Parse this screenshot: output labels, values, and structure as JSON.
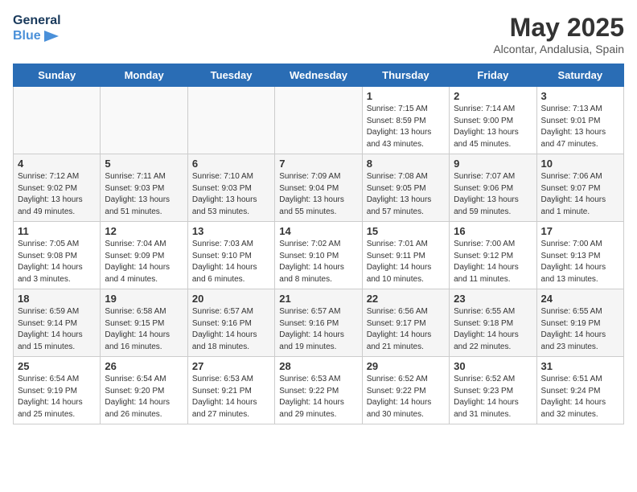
{
  "header": {
    "logo_line1": "General",
    "logo_line2": "Blue",
    "title": "May 2025",
    "subtitle": "Alcontar, Andalusia, Spain"
  },
  "weekdays": [
    "Sunday",
    "Monday",
    "Tuesday",
    "Wednesday",
    "Thursday",
    "Friday",
    "Saturday"
  ],
  "weeks": [
    [
      {
        "day": "",
        "info": ""
      },
      {
        "day": "",
        "info": ""
      },
      {
        "day": "",
        "info": ""
      },
      {
        "day": "",
        "info": ""
      },
      {
        "day": "1",
        "info": "Sunrise: 7:15 AM\nSunset: 8:59 PM\nDaylight: 13 hours\nand 43 minutes."
      },
      {
        "day": "2",
        "info": "Sunrise: 7:14 AM\nSunset: 9:00 PM\nDaylight: 13 hours\nand 45 minutes."
      },
      {
        "day": "3",
        "info": "Sunrise: 7:13 AM\nSunset: 9:01 PM\nDaylight: 13 hours\nand 47 minutes."
      }
    ],
    [
      {
        "day": "4",
        "info": "Sunrise: 7:12 AM\nSunset: 9:02 PM\nDaylight: 13 hours\nand 49 minutes."
      },
      {
        "day": "5",
        "info": "Sunrise: 7:11 AM\nSunset: 9:03 PM\nDaylight: 13 hours\nand 51 minutes."
      },
      {
        "day": "6",
        "info": "Sunrise: 7:10 AM\nSunset: 9:03 PM\nDaylight: 13 hours\nand 53 minutes."
      },
      {
        "day": "7",
        "info": "Sunrise: 7:09 AM\nSunset: 9:04 PM\nDaylight: 13 hours\nand 55 minutes."
      },
      {
        "day": "8",
        "info": "Sunrise: 7:08 AM\nSunset: 9:05 PM\nDaylight: 13 hours\nand 57 minutes."
      },
      {
        "day": "9",
        "info": "Sunrise: 7:07 AM\nSunset: 9:06 PM\nDaylight: 13 hours\nand 59 minutes."
      },
      {
        "day": "10",
        "info": "Sunrise: 7:06 AM\nSunset: 9:07 PM\nDaylight: 14 hours\nand 1 minute."
      }
    ],
    [
      {
        "day": "11",
        "info": "Sunrise: 7:05 AM\nSunset: 9:08 PM\nDaylight: 14 hours\nand 3 minutes."
      },
      {
        "day": "12",
        "info": "Sunrise: 7:04 AM\nSunset: 9:09 PM\nDaylight: 14 hours\nand 4 minutes."
      },
      {
        "day": "13",
        "info": "Sunrise: 7:03 AM\nSunset: 9:10 PM\nDaylight: 14 hours\nand 6 minutes."
      },
      {
        "day": "14",
        "info": "Sunrise: 7:02 AM\nSunset: 9:10 PM\nDaylight: 14 hours\nand 8 minutes."
      },
      {
        "day": "15",
        "info": "Sunrise: 7:01 AM\nSunset: 9:11 PM\nDaylight: 14 hours\nand 10 minutes."
      },
      {
        "day": "16",
        "info": "Sunrise: 7:00 AM\nSunset: 9:12 PM\nDaylight: 14 hours\nand 11 minutes."
      },
      {
        "day": "17",
        "info": "Sunrise: 7:00 AM\nSunset: 9:13 PM\nDaylight: 14 hours\nand 13 minutes."
      }
    ],
    [
      {
        "day": "18",
        "info": "Sunrise: 6:59 AM\nSunset: 9:14 PM\nDaylight: 14 hours\nand 15 minutes."
      },
      {
        "day": "19",
        "info": "Sunrise: 6:58 AM\nSunset: 9:15 PM\nDaylight: 14 hours\nand 16 minutes."
      },
      {
        "day": "20",
        "info": "Sunrise: 6:57 AM\nSunset: 9:16 PM\nDaylight: 14 hours\nand 18 minutes."
      },
      {
        "day": "21",
        "info": "Sunrise: 6:57 AM\nSunset: 9:16 PM\nDaylight: 14 hours\nand 19 minutes."
      },
      {
        "day": "22",
        "info": "Sunrise: 6:56 AM\nSunset: 9:17 PM\nDaylight: 14 hours\nand 21 minutes."
      },
      {
        "day": "23",
        "info": "Sunrise: 6:55 AM\nSunset: 9:18 PM\nDaylight: 14 hours\nand 22 minutes."
      },
      {
        "day": "24",
        "info": "Sunrise: 6:55 AM\nSunset: 9:19 PM\nDaylight: 14 hours\nand 23 minutes."
      }
    ],
    [
      {
        "day": "25",
        "info": "Sunrise: 6:54 AM\nSunset: 9:19 PM\nDaylight: 14 hours\nand 25 minutes."
      },
      {
        "day": "26",
        "info": "Sunrise: 6:54 AM\nSunset: 9:20 PM\nDaylight: 14 hours\nand 26 minutes."
      },
      {
        "day": "27",
        "info": "Sunrise: 6:53 AM\nSunset: 9:21 PM\nDaylight: 14 hours\nand 27 minutes."
      },
      {
        "day": "28",
        "info": "Sunrise: 6:53 AM\nSunset: 9:22 PM\nDaylight: 14 hours\nand 29 minutes."
      },
      {
        "day": "29",
        "info": "Sunrise: 6:52 AM\nSunset: 9:22 PM\nDaylight: 14 hours\nand 30 minutes."
      },
      {
        "day": "30",
        "info": "Sunrise: 6:52 AM\nSunset: 9:23 PM\nDaylight: 14 hours\nand 31 minutes."
      },
      {
        "day": "31",
        "info": "Sunrise: 6:51 AM\nSunset: 9:24 PM\nDaylight: 14 hours\nand 32 minutes."
      }
    ]
  ]
}
